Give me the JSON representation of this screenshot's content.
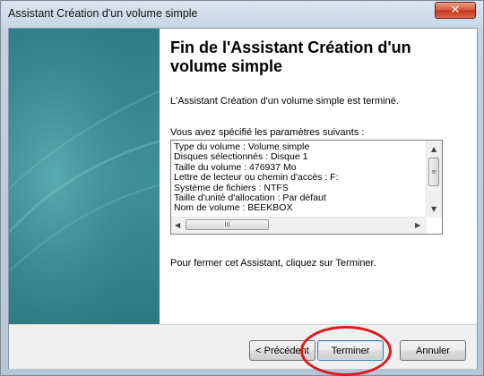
{
  "window": {
    "title": "Assistant Création d'un volume simple",
    "close_icon": "close-icon",
    "close_glyph": "✕"
  },
  "content": {
    "heading": "Fin de l'Assistant Création d'un volume simple",
    "completed_text": "L'Assistant Création d'un volume simple est terminé.",
    "params_label": "Vous avez spécifié les paramètres suivants :",
    "params": [
      "Type du volume : Volume simple",
      "Disques sélectionnés : Disque 1",
      "Taille du volume : 476937 Mo",
      "Lettre de lecteur ou chemin d'accès : F:",
      "Système de fichiers : NTFS",
      "Taille d'unité d'allocation : Par défaut",
      "Nom de volume : BEEKBOX"
    ],
    "close_instruction": "Pour fermer cet Assistant, cliquez sur Terminer."
  },
  "buttons": {
    "previous": "< Précédent",
    "finish": "Terminer",
    "cancel": "Annuler"
  },
  "scrollbars": {
    "thumb_grip_v": "≡",
    "thumb_grip_h": "III",
    "arrow_up": "▲",
    "arrow_down": "▼",
    "arrow_left": "◀",
    "arrow_right": "▶"
  },
  "colors": {
    "annotation": "#de1a1f",
    "side_panel": "#2d7f86"
  }
}
